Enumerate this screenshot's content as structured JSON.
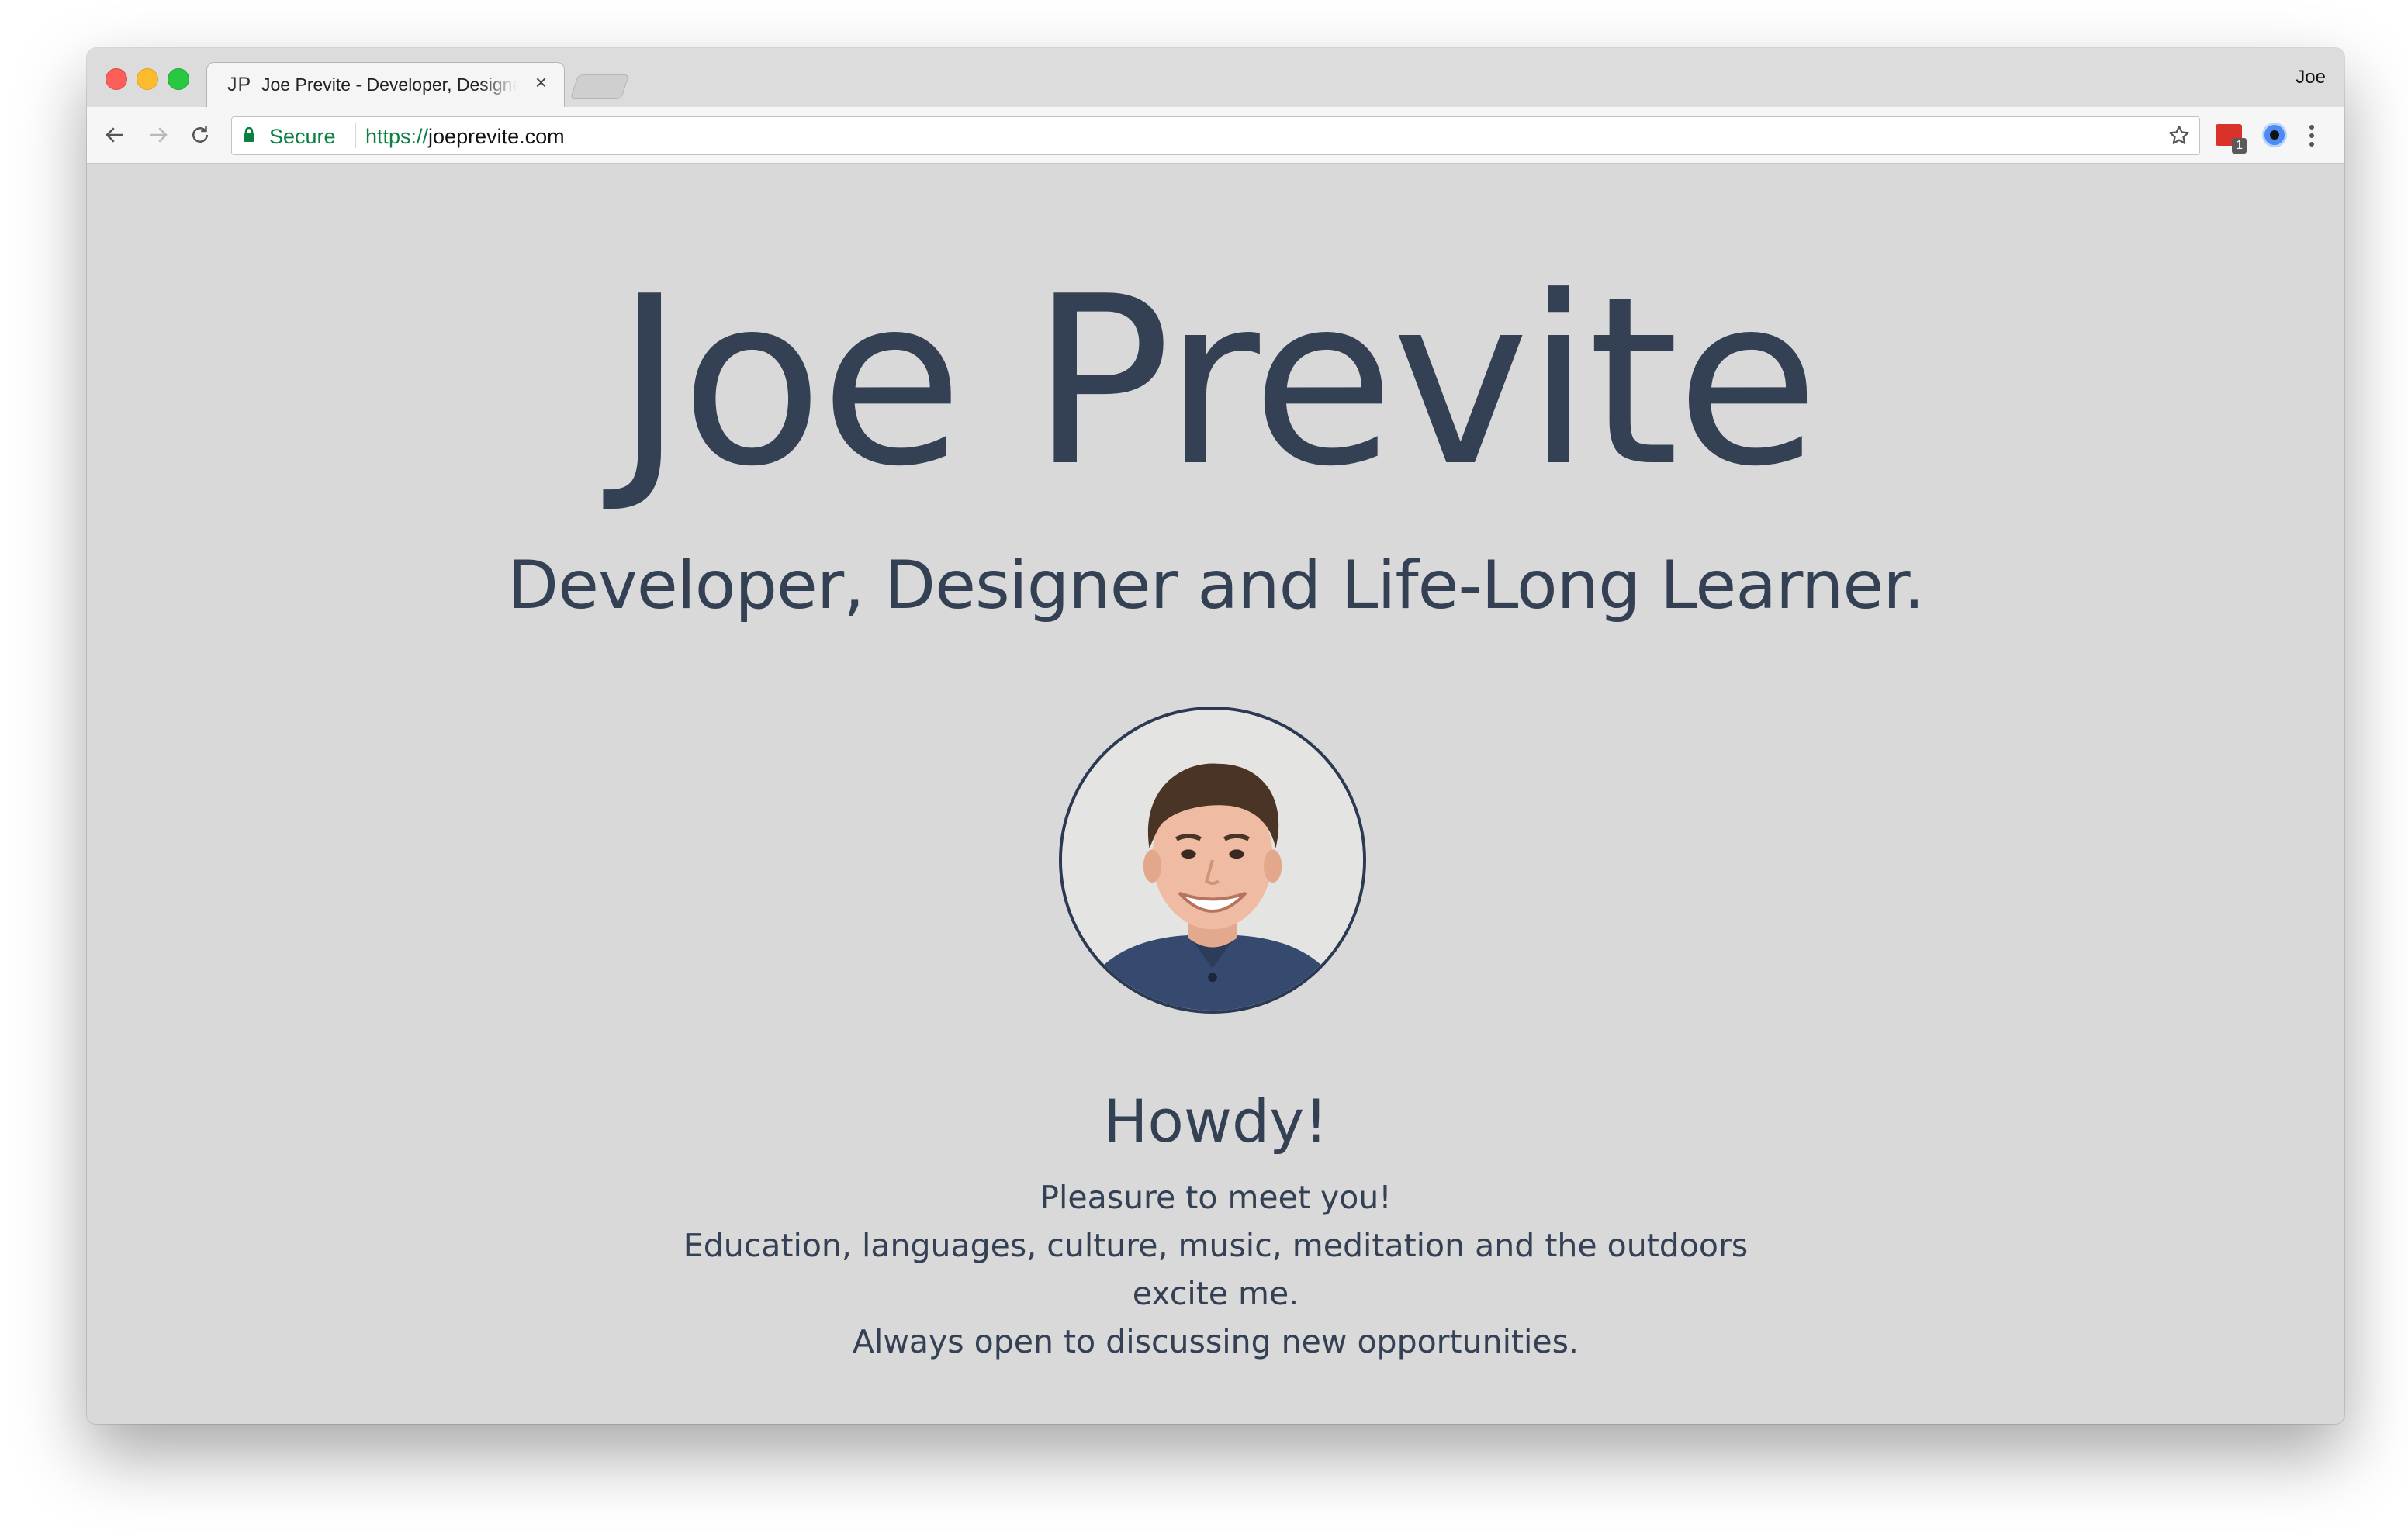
{
  "browser": {
    "tab": {
      "favicon_text": "JP",
      "title": "Joe Previte - Developer, Designer and Life-Long Learner.",
      "close_glyph": "×"
    },
    "profile_name": "Joe",
    "address_bar": {
      "secure_label": "Secure",
      "url_scheme": "https://",
      "url_host": "joeprevite.com"
    },
    "extensions": [
      {
        "icon": "calendar-extension-icon",
        "badge": "1",
        "color": "#d9322b"
      },
      {
        "icon": "eye-extension-icon",
        "color": "#4c8bf5"
      }
    ],
    "icons": {
      "back": "arrow-left-icon",
      "forward": "arrow-right-icon",
      "reload": "reload-icon",
      "bookmark": "star-icon",
      "menu": "kebab-menu-icon"
    }
  },
  "page": {
    "name": "Joe Previte",
    "tagline": "Developer, Designer and Life-Long Learner.",
    "greeting": "Howdy!",
    "bio_lines": [
      "Pleasure to meet you!",
      "Education, languages, culture, music, meditation and the outdoors excite me.",
      "Always open to discussing new opportunities."
    ],
    "colors": {
      "background": "#d9d9d9",
      "text": "#344155"
    }
  }
}
